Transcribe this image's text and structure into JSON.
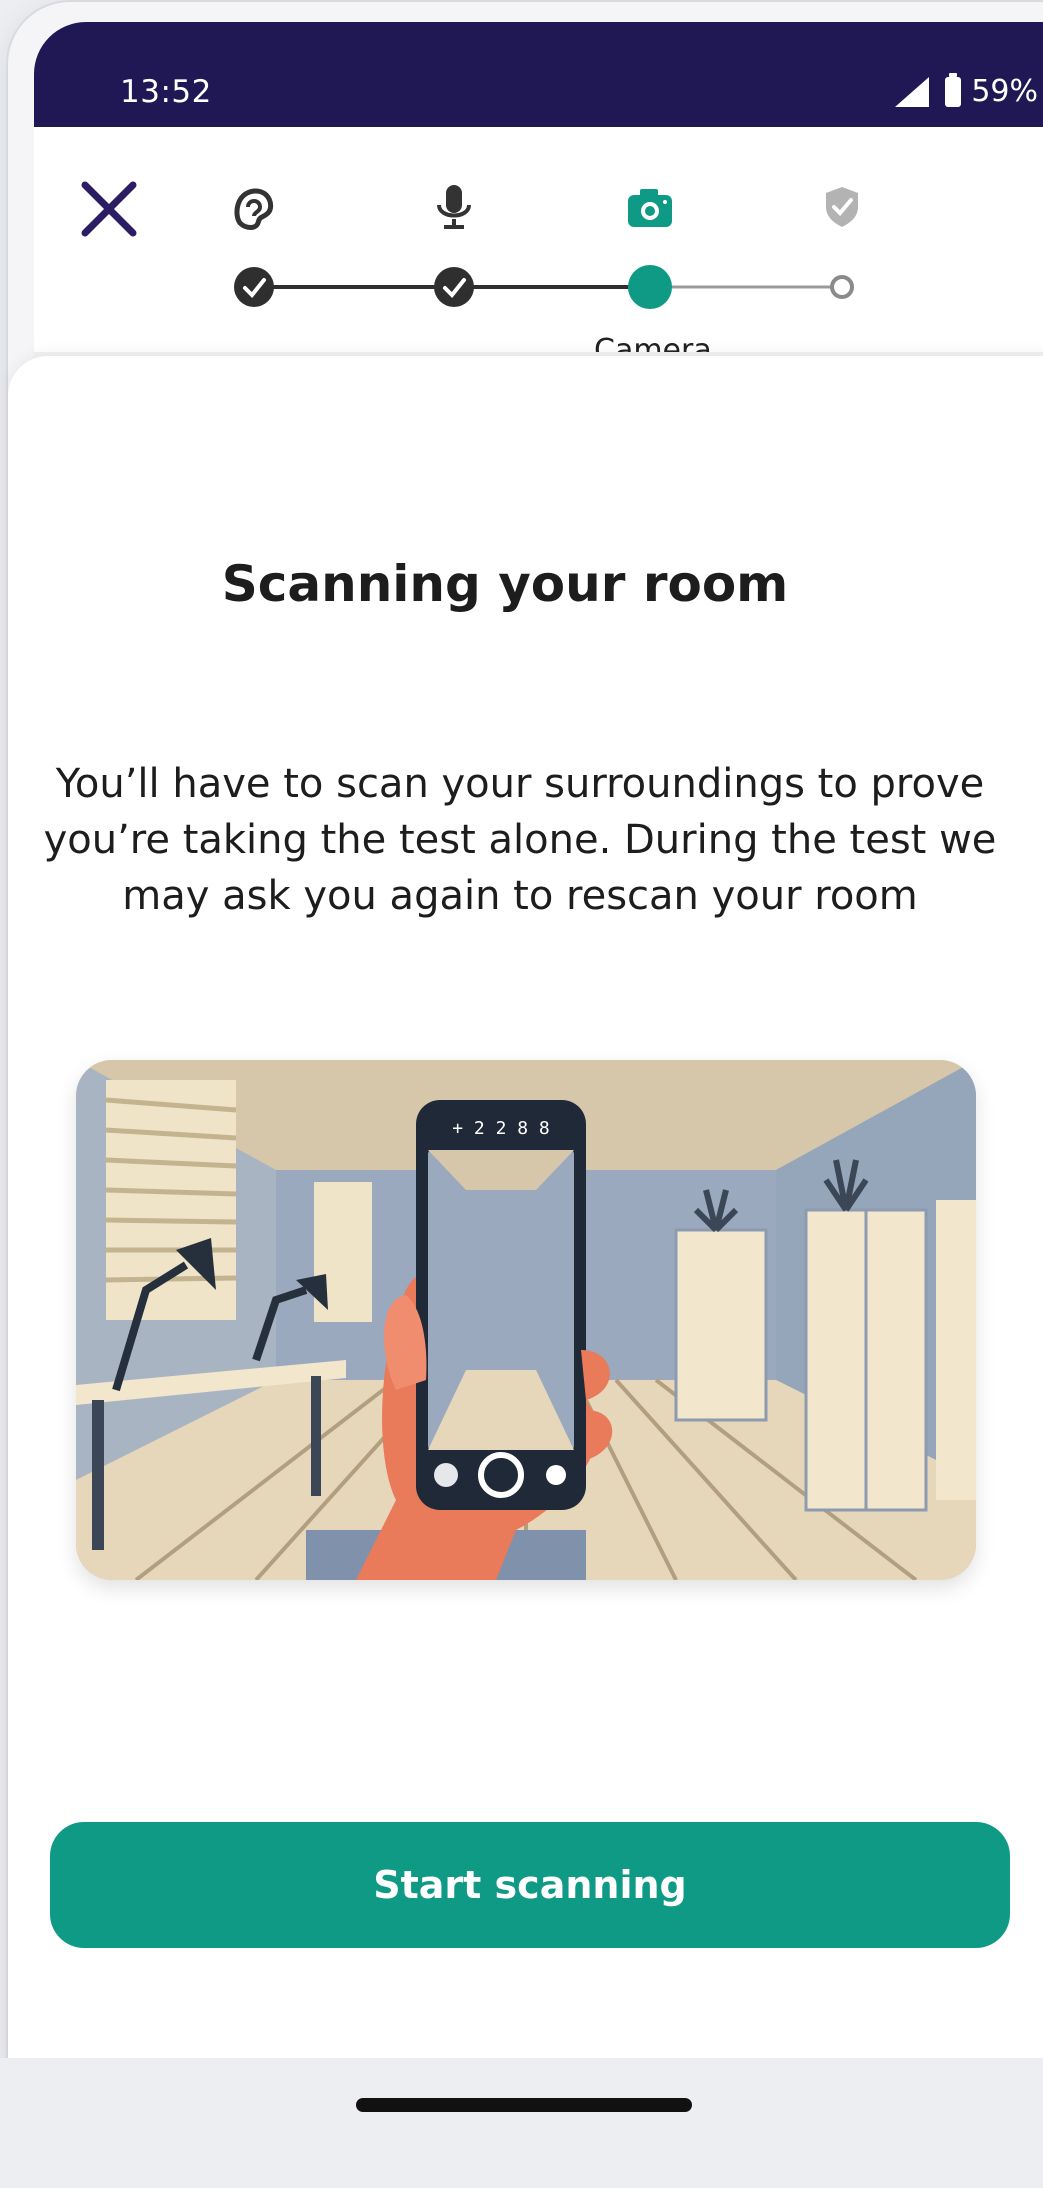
{
  "status_bar": {
    "time": "13:52",
    "battery": "59%",
    "signal_icon": "signal-icon",
    "battery_icon": "battery-icon"
  },
  "header": {
    "close_icon": "close-icon",
    "steps": [
      {
        "icon": "ear-icon",
        "state": "done"
      },
      {
        "icon": "microphone-icon",
        "state": "done"
      },
      {
        "icon": "camera-icon",
        "state": "current",
        "label": "Camera"
      },
      {
        "icon": "shield-check-icon",
        "state": "pending"
      }
    ],
    "current_step_label": "Camera"
  },
  "main": {
    "title": "Scanning your room",
    "description": "You’ll have to scan your surroundings to prove you’re taking the test alone. During the test we may ask you again to rescan your room",
    "illustration_phone_text": "+ 2 2 8 8"
  },
  "cta": {
    "label": "Start scanning"
  },
  "colors": {
    "statusbar": "#1f1854",
    "accent": "#0f9a86",
    "step_done": "#333333",
    "close": "#2b1c63"
  }
}
